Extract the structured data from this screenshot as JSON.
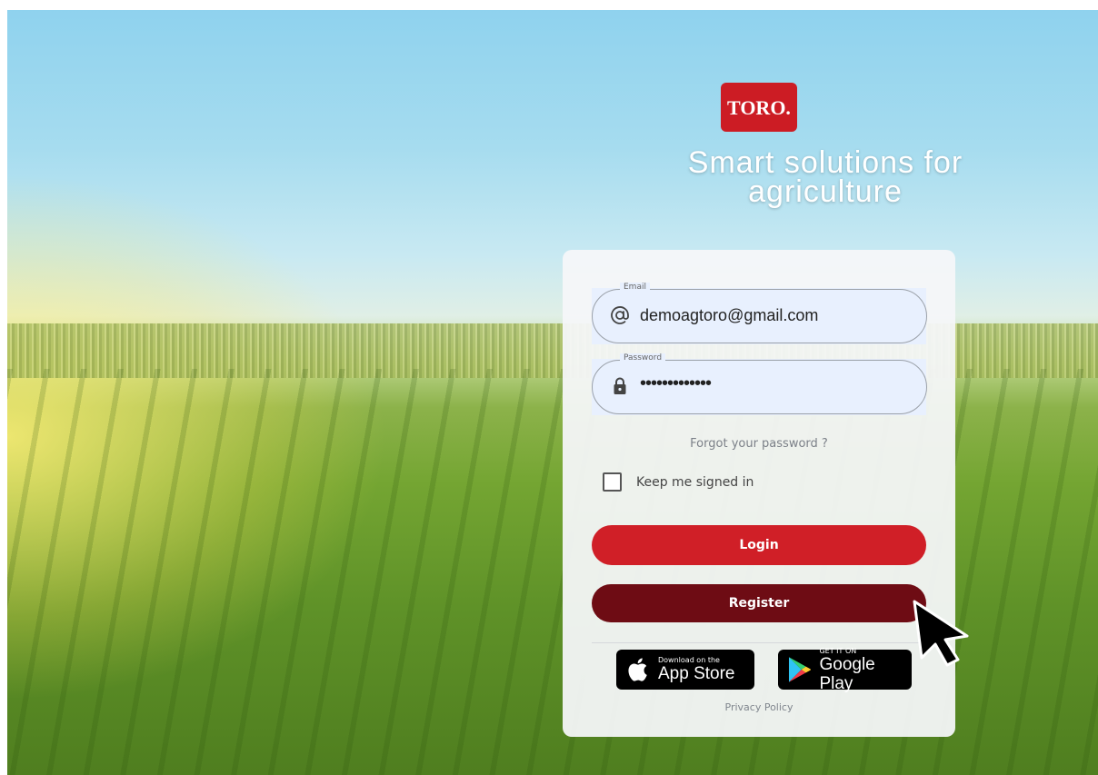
{
  "brand": {
    "logo_text": "TORO.",
    "accent_color": "#cc1c24"
  },
  "headline": {
    "line1": "Smart solutions for",
    "line2": "agriculture"
  },
  "login_form": {
    "email": {
      "label": "Email",
      "value": "demoagtoro@gmail.com",
      "icon": "at-icon"
    },
    "password": {
      "label": "Password",
      "value": "•••••••••••••",
      "icon": "lock-icon"
    },
    "forgot_password": "Forgot your password ?",
    "keep_signed_in": {
      "label": "Keep me signed in",
      "checked": false
    },
    "login_label": "Login",
    "register_label": "Register",
    "login_color": "#d01f27",
    "register_color": "#6e0c14"
  },
  "app_badges": {
    "apple": {
      "top_text": "Download on the",
      "bottom_text": "App Store",
      "icon": "apple-icon"
    },
    "google": {
      "top_text": "GET IT ON",
      "bottom_text": "Google Play",
      "icon": "google-play-icon"
    }
  },
  "footer": {
    "privacy_label": "Privacy Policy"
  },
  "cursor": {
    "icon": "mouse-pointer-icon"
  }
}
